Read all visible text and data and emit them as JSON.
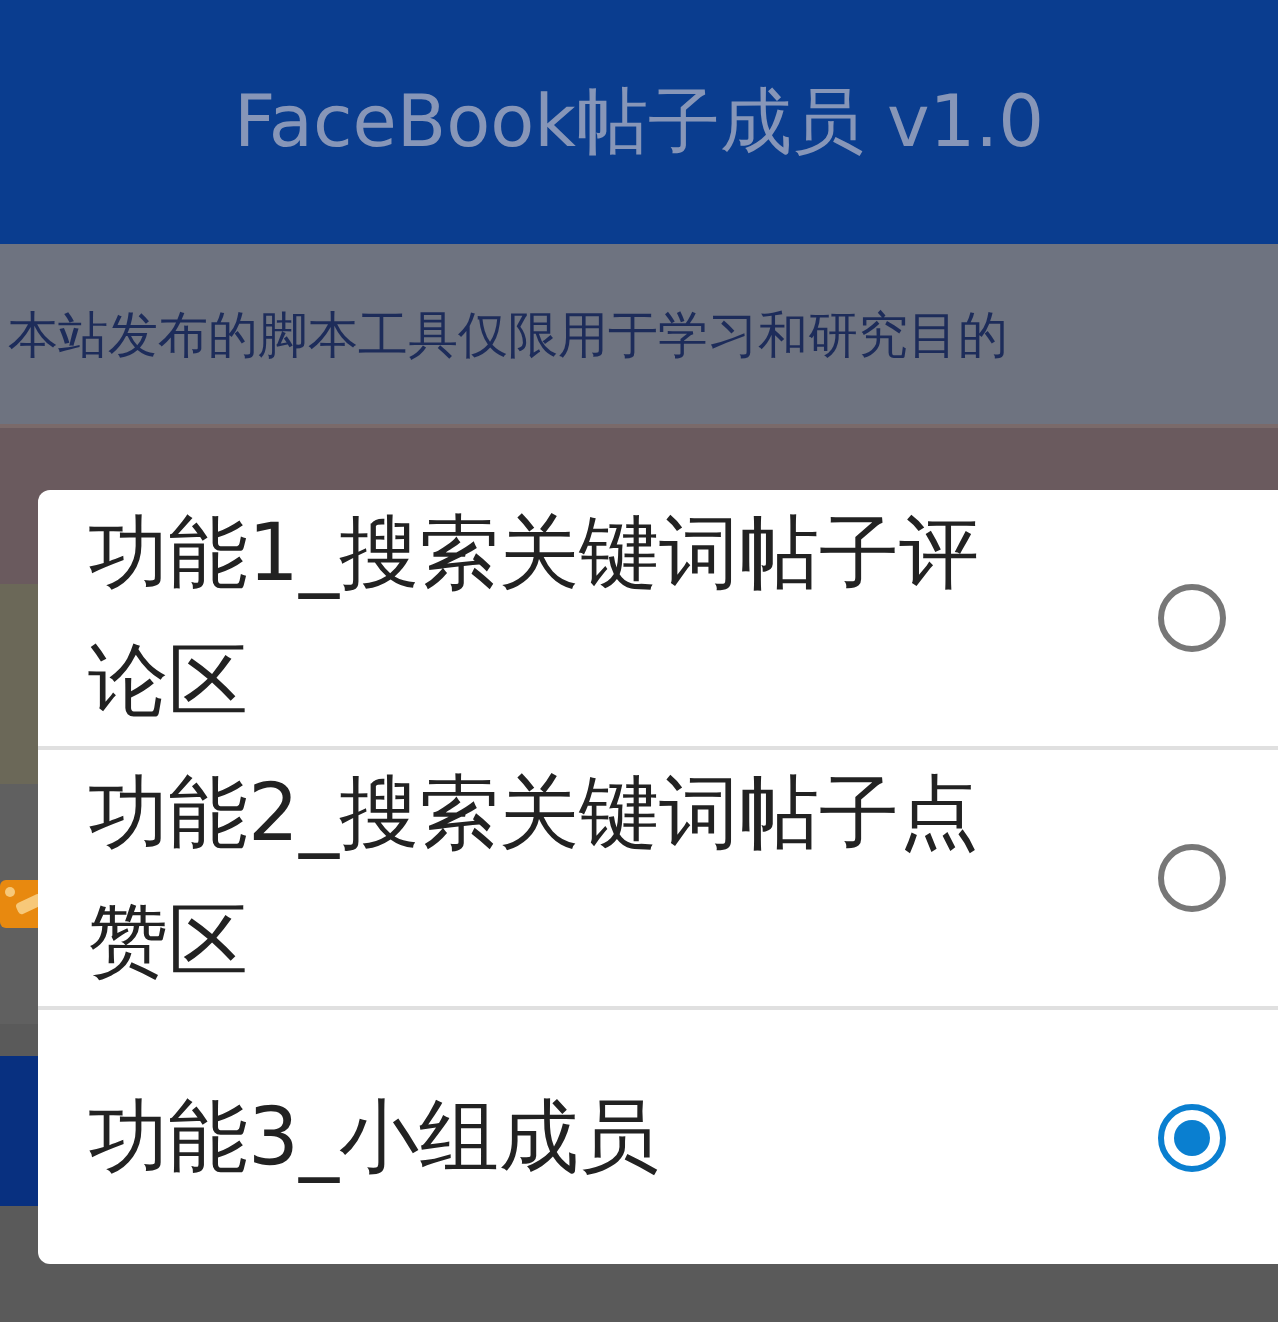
{
  "header": {
    "title": "FaceBook帖子成员 v1.0"
  },
  "background_rows": [
    {
      "kind": "notice",
      "text": "本站发布的脚本工具仅限用于学习和研究目的"
    },
    {
      "kind": "warning"
    },
    {
      "kind": "tip"
    },
    {
      "kind": "plain"
    },
    {
      "kind": "plain_icon"
    },
    {
      "kind": "bar"
    }
  ],
  "dialog": {
    "options": [
      {
        "label": "功能1_搜索关键词帖子评论区",
        "selected": false
      },
      {
        "label": "功能2_搜索关键词帖子点赞区",
        "selected": false
      },
      {
        "label": "功能3_小组成员",
        "selected": true
      }
    ]
  }
}
